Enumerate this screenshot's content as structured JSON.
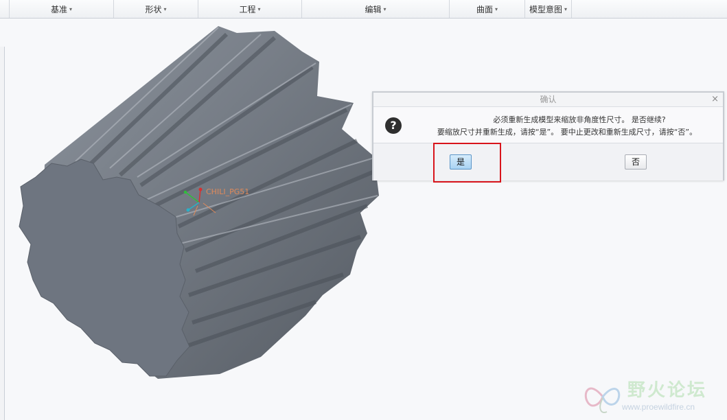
{
  "ribbon": {
    "groups": [
      {
        "label": "基准"
      },
      {
        "label": "形状"
      },
      {
        "label": "工程"
      },
      {
        "label": "编辑"
      },
      {
        "label": "曲面"
      },
      {
        "label": "模型意图"
      }
    ],
    "caret": "▾"
  },
  "viewport": {
    "csys_label": "CHILI_PG51"
  },
  "dialog": {
    "title": "确认",
    "close": "×",
    "icon": "?",
    "message_line1": "必须重新生成模型来缩放非角度性尺寸。 是否继续?",
    "message_line2": "要缩放尺寸并重新生成，请按“是”。 要中止更改和重新生成尺寸，请按“否”。",
    "yes_label": "是",
    "no_label": "否"
  },
  "watermark": {
    "name": "野火论坛",
    "url": "www.proewildfire.cn"
  }
}
